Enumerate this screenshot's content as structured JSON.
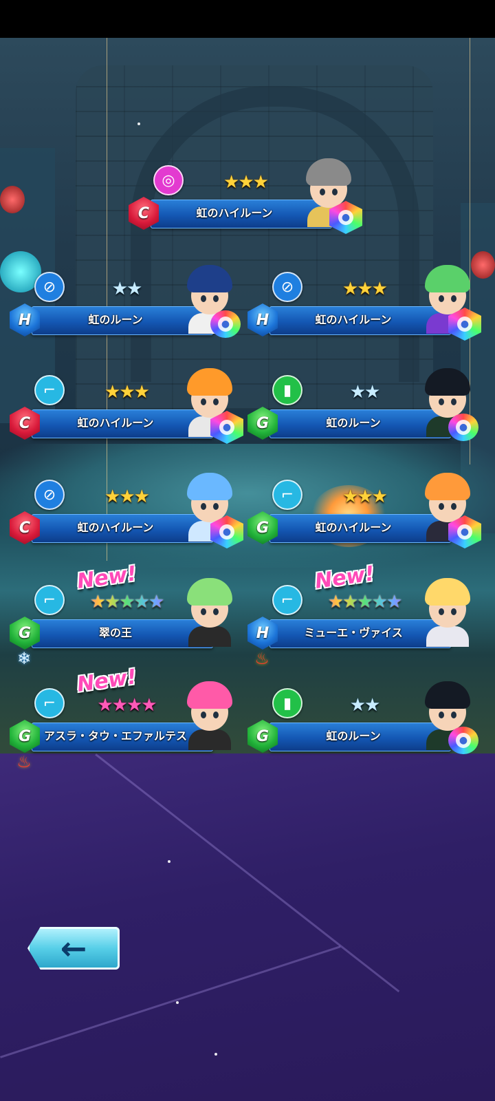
{
  "rewards": [
    {
      "id": "r1",
      "name": "虹のハイルーン",
      "rank": "C",
      "category": "swirl-icon",
      "stars": "★★★",
      "star_color": "gold",
      "portrait": {
        "hair": "#8a8a8a",
        "body": "#e6c35a"
      },
      "rune": "hex",
      "is_new": false,
      "element": ""
    },
    {
      "id": "r2",
      "name": "虹のルーン",
      "rank": "H",
      "category": "racket-icon",
      "stars": "★★",
      "star_color": "silver",
      "portrait": {
        "hair": "#1e3f8a",
        "body": "#f0f0f0"
      },
      "rune": "round",
      "is_new": false,
      "element": ""
    },
    {
      "id": "r3",
      "name": "虹のハイルーン",
      "rank": "H",
      "category": "racket-icon",
      "stars": "★★★",
      "star_color": "gold",
      "portrait": {
        "hair": "#5ad06a",
        "body": "#7a3ad0"
      },
      "rune": "hex",
      "is_new": false,
      "element": ""
    },
    {
      "id": "r4",
      "name": "虹のハイルーン",
      "rank": "C",
      "category": "shoe-icon",
      "stars": "★★★",
      "star_color": "gold",
      "portrait": {
        "hair": "#ff9a2a",
        "body": "#e8e8e8"
      },
      "rune": "hex",
      "is_new": false,
      "element": ""
    },
    {
      "id": "r5",
      "name": "虹のルーン",
      "rank": "G",
      "category": "bottle-icon",
      "stars": "★★",
      "star_color": "silver",
      "portrait": {
        "hair": "#141a24",
        "body": "#1e3a2a"
      },
      "rune": "round",
      "is_new": false,
      "element": ""
    },
    {
      "id": "r6",
      "name": "虹のハイルーン",
      "rank": "C",
      "category": "racket-icon",
      "stars": "★★★",
      "star_color": "gold",
      "portrait": {
        "hair": "#6ab8ff",
        "body": "#cfe8ff"
      },
      "rune": "hex",
      "is_new": false,
      "element": ""
    },
    {
      "id": "r7",
      "name": "虹のハイルーン",
      "rank": "G",
      "category": "shoe-icon",
      "stars": "★★★",
      "star_color": "gold",
      "portrait": {
        "hair": "#ff9a3a",
        "body": "#2a2a3a"
      },
      "rune": "hex",
      "is_new": false,
      "element": ""
    },
    {
      "id": "r8",
      "name": "翠の王",
      "rank": "G",
      "category": "shoe-icon",
      "stars": "★★★★★",
      "star_color": "rainbow",
      "portrait": {
        "hair": "#8ae07a",
        "body": "#2a2a2a"
      },
      "rune": "none",
      "is_new": true,
      "element": "ice-icon"
    },
    {
      "id": "r9",
      "name": "ミューエ・ヴァイス",
      "rank": "H",
      "category": "shoe-icon",
      "stars": "★★★★★",
      "star_color": "rainbow",
      "portrait": {
        "hair": "#ffd86a",
        "body": "#e8e8f0"
      },
      "rune": "none",
      "is_new": true,
      "element": "fire-icon"
    },
    {
      "id": "r10",
      "name": "アスラ・タウ・エファルテス",
      "rank": "G",
      "category": "shoe-icon",
      "stars": "★★★★",
      "star_color": "pink",
      "portrait": {
        "hair": "#ff5aa8",
        "body": "#2a2a2a"
      },
      "rune": "none",
      "is_new": true,
      "element": "fire-icon"
    },
    {
      "id": "r11",
      "name": "虹のルーン",
      "rank": "G",
      "category": "bottle-icon",
      "stars": "★★",
      "star_color": "silver",
      "portrait": {
        "hair": "#141a24",
        "body": "#1e3a2a"
      },
      "rune": "round",
      "is_new": false,
      "element": ""
    }
  ],
  "new_badge_label": "New!",
  "back_button": {
    "label": "←",
    "icon": "back-arrow-icon"
  },
  "colors": {
    "panel": "#1457b3",
    "accent": "#57cfe8"
  }
}
